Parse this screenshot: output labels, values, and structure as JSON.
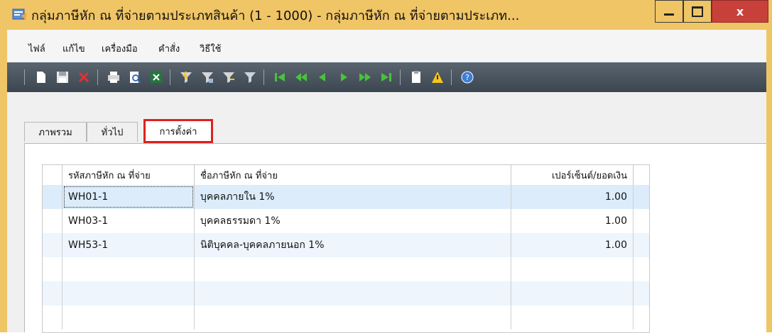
{
  "window": {
    "title": "กลุ่มภาษีหัก ณ ที่จ่ายตามประเภทสินค้า (1 - 1000) - กลุ่มภาษีหัก ณ ที่จ่ายตามประเภท...",
    "close_label": "x"
  },
  "menu": {
    "items": [
      "ไฟล์",
      "แก้ไข",
      "เครื่องมือ",
      "คำสั่ง",
      "วิธีใช้"
    ]
  },
  "toolbar": {
    "icons": [
      "new-record-icon",
      "save-icon",
      "delete-icon",
      "print-icon",
      "print-preview-icon",
      "export-excel-icon",
      "filter-by-selection-icon",
      "filter-by-field-icon",
      "advanced-filter-icon",
      "remove-filter-icon",
      "first-record-icon",
      "previous-page-icon",
      "previous-record-icon",
      "next-record-icon",
      "next-page-icon",
      "last-record-icon",
      "document-handling-icon",
      "alert-icon",
      "help-icon"
    ]
  },
  "tabs": [
    "ภาพรวม",
    "ทั่วไป",
    "การตั้งค่า"
  ],
  "grid": {
    "headers": [
      "รหัสภาษีหัก ณ ที่จ่าย",
      "ชื่อภาษีหัก ณ ที่จ่าย",
      "เปอร์เซ็นต์/ยอดเงิน"
    ],
    "rows": [
      {
        "code": "WH01-1",
        "name": "บุคคลภายใน 1%",
        "value": "1.00"
      },
      {
        "code": "WH03-1",
        "name": "บุคคลธรรมดา 1%",
        "value": "1.00"
      },
      {
        "code": "WH53-1",
        "name": "นิติบุคคล-บุคคลภายนอก 1%",
        "value": "1.00"
      }
    ]
  },
  "colors": {
    "title_bar": "#f0c566",
    "close_button": "#c7413a",
    "tab_highlight": "#e0201e",
    "selected_row": "#dcecfa",
    "toolbar": "#4a545e"
  }
}
